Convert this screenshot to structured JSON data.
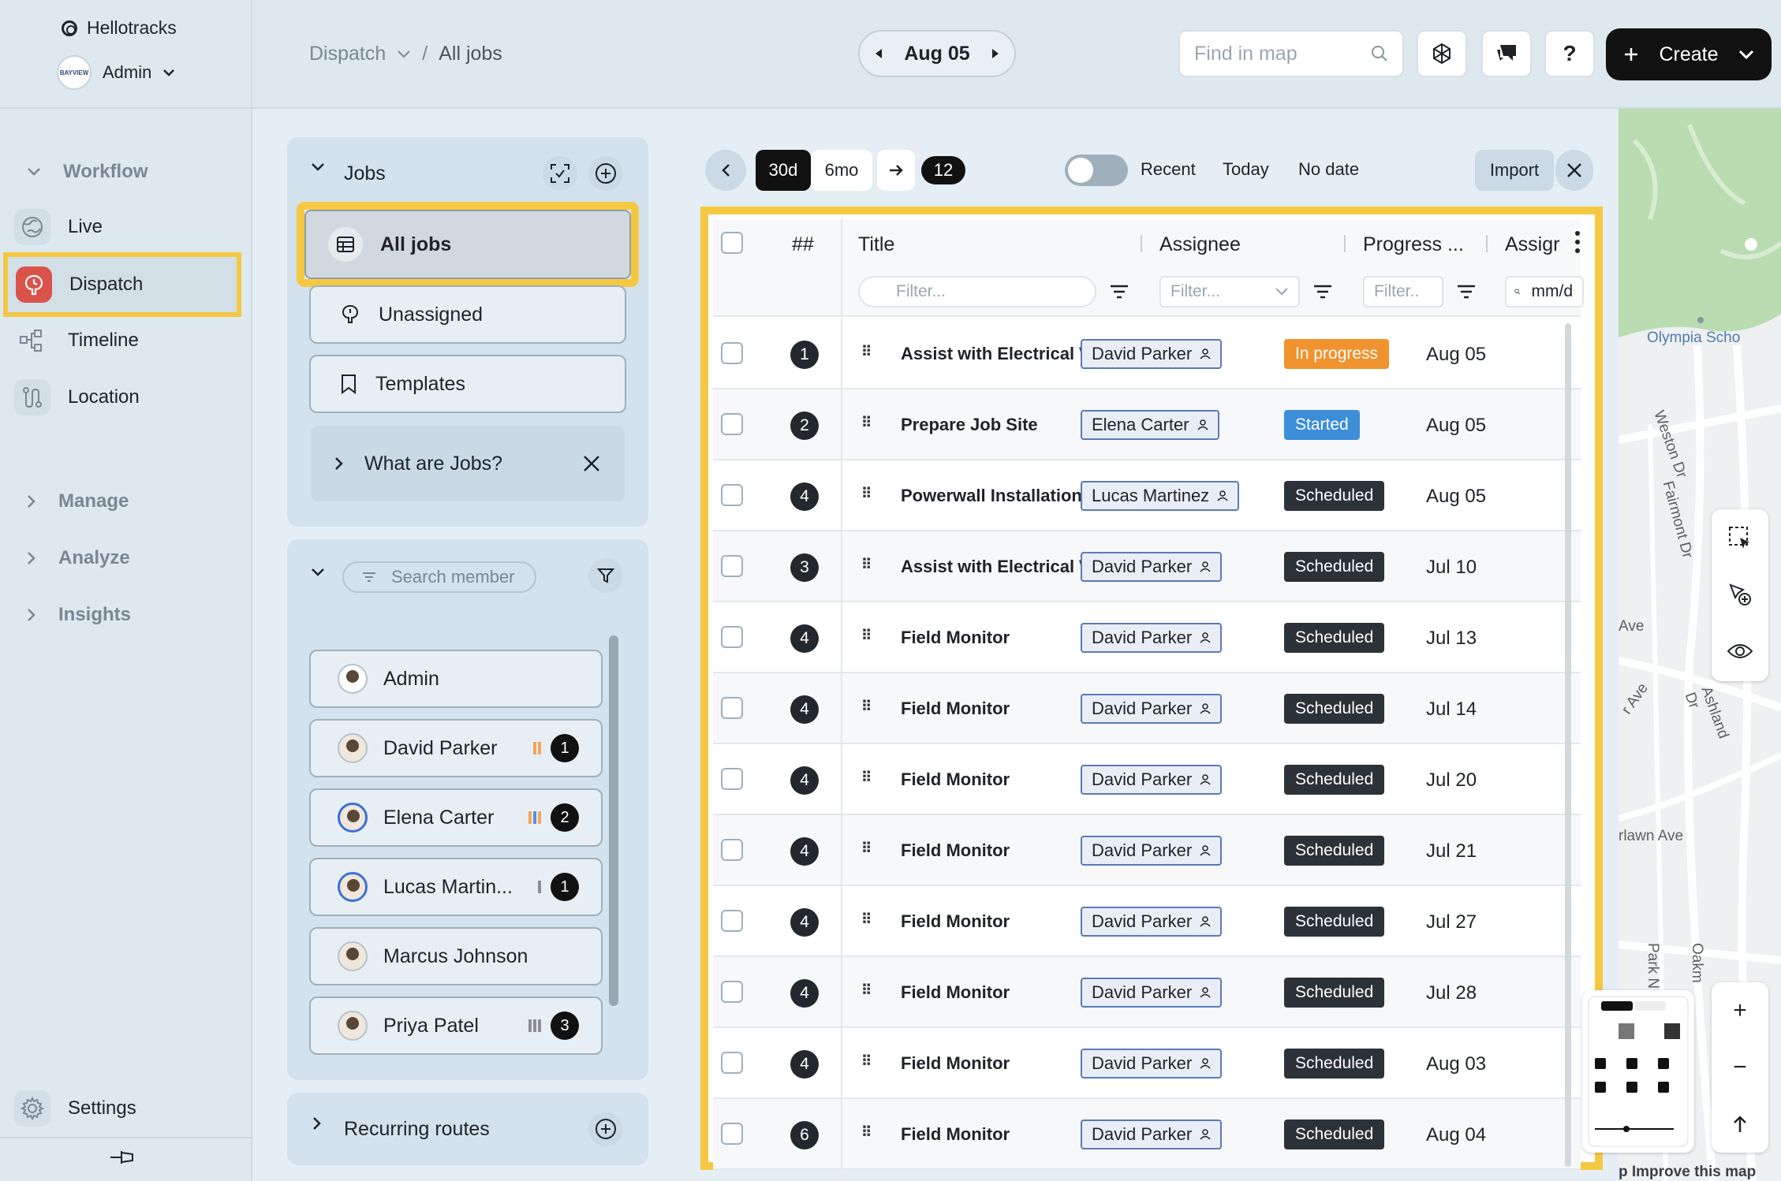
{
  "app": {
    "name": "Hellotracks",
    "user": "Admin",
    "user_logo_text": "BAYVIEW"
  },
  "sidebar": {
    "sections": {
      "workflow": "Workflow",
      "manage": "Manage",
      "analyze": "Analyze",
      "insights": "Insights"
    },
    "items": [
      {
        "label": "Live",
        "icon": "globe-icon"
      },
      {
        "label": "Dispatch",
        "icon": "dispatch-icon"
      },
      {
        "label": "Timeline",
        "icon": "timeline-icon"
      },
      {
        "label": "Location",
        "icon": "route-icon"
      }
    ],
    "settings": "Settings"
  },
  "header": {
    "breadcrumb_root": "Dispatch",
    "breadcrumb_current": "All jobs",
    "date": "Aug 05",
    "search_placeholder": "Find in map",
    "help": "?",
    "create": "Create"
  },
  "jobs_panel": {
    "title": "Jobs",
    "items": [
      "All jobs",
      "Unassigned",
      "Templates"
    ],
    "info": "What are Jobs?"
  },
  "members_panel": {
    "search_placeholder": "Search member",
    "members": [
      {
        "name": "Admin",
        "count": ""
      },
      {
        "name": "David Parker",
        "count": "1"
      },
      {
        "name": "Elena Carter",
        "count": "2"
      },
      {
        "name": "Lucas Martin...",
        "count": "1"
      },
      {
        "name": "Marcus Johnson",
        "count": ""
      },
      {
        "name": "Priya Patel",
        "count": "3"
      }
    ],
    "recurring": "Recurring routes"
  },
  "toolbar": {
    "range_30d": "30d",
    "range_6mo": "6mo",
    "badge": "12",
    "recent": "Recent",
    "today": "Today",
    "no_date": "No date",
    "import": "Import"
  },
  "table": {
    "columns": {
      "num": "##",
      "title": "Title",
      "assignee": "Assignee",
      "progress": "Progress ...",
      "assign_date": "Assigr"
    },
    "filter_placeholder": "Filter...",
    "filter_short": "Filter..",
    "date_placeholder": "mm/d",
    "rows": [
      {
        "num": "1",
        "title": "Assist with Electrical Wiring",
        "assignee": "David Parker",
        "progress": "In progress",
        "date": "Aug 05"
      },
      {
        "num": "2",
        "title": "Prepare Job Site",
        "assignee": "Elena Carter",
        "progress": "Started",
        "date": "Aug 05"
      },
      {
        "num": "4",
        "title": "Powerwall Installation",
        "assignee": "Lucas Martinez",
        "progress": "Scheduled",
        "date": "Aug 05"
      },
      {
        "num": "3",
        "title": "Assist with Electrical Wiring",
        "assignee": "David Parker",
        "progress": "Scheduled",
        "date": "Jul 10"
      },
      {
        "num": "4",
        "title": "Field Monitor",
        "assignee": "David Parker",
        "progress": "Scheduled",
        "date": "Jul 13"
      },
      {
        "num": "4",
        "title": "Field Monitor",
        "assignee": "David Parker",
        "progress": "Scheduled",
        "date": "Jul 14"
      },
      {
        "num": "4",
        "title": "Field Monitor",
        "assignee": "David Parker",
        "progress": "Scheduled",
        "date": "Jul 20"
      },
      {
        "num": "4",
        "title": "Field Monitor",
        "assignee": "David Parker",
        "progress": "Scheduled",
        "date": "Jul 21"
      },
      {
        "num": "4",
        "title": "Field Monitor",
        "assignee": "David Parker",
        "progress": "Scheduled",
        "date": "Jul 27"
      },
      {
        "num": "4",
        "title": "Field Monitor",
        "assignee": "David Parker",
        "progress": "Scheduled",
        "date": "Jul 28"
      },
      {
        "num": "4",
        "title": "Field Monitor",
        "assignee": "David Parker",
        "progress": "Scheduled",
        "date": "Aug 03"
      },
      {
        "num": "6",
        "title": "Field Monitor",
        "assignee": "David Parker",
        "progress": "Scheduled",
        "date": "Aug 04"
      }
    ]
  },
  "map": {
    "labels": [
      "Olympia Scho",
      "Weston Dr",
      "Fairmont Dr",
      "Ave",
      "r Ave",
      "Ashland Dr",
      "rlawn Ave",
      "Park N",
      "Oakm",
      "p Improve this map"
    ],
    "zoom_in": "+",
    "zoom_out": "−"
  },
  "colors": {
    "highlight": "#f5c842",
    "in_progress": "#f0922e",
    "started": "#3c8ed8",
    "scheduled": "#2b3238",
    "dispatch": "#d9534a"
  }
}
